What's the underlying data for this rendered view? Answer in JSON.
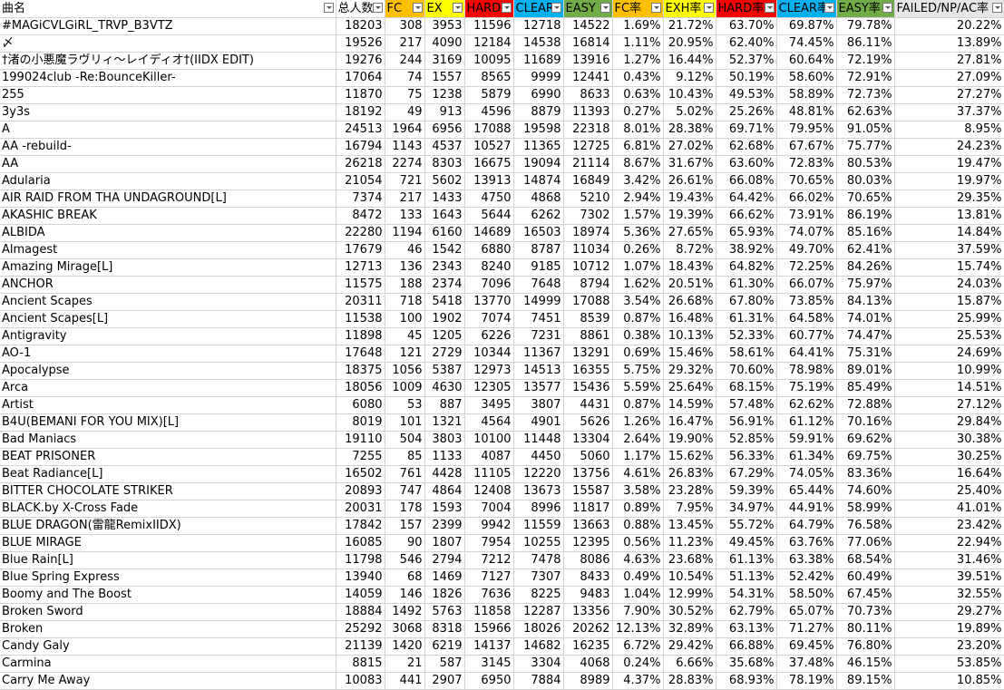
{
  "headers": [
    {
      "label": "曲名",
      "color": "#ffffff"
    },
    {
      "label": "总人数",
      "color": "#ffffff"
    },
    {
      "label": "FC",
      "color": "#ffc000"
    },
    {
      "label": "EX",
      "color": "#ffff00"
    },
    {
      "label": "HARD",
      "color": "#ff0000"
    },
    {
      "label": "CLEAR",
      "color": "#00b0f0"
    },
    {
      "label": "EASY",
      "color": "#70ad47"
    },
    {
      "label": "FC率",
      "color": "#ffc000"
    },
    {
      "label": "EXH率",
      "color": "#ffff00"
    },
    {
      "label": "HARD率",
      "color": "#ff0000"
    },
    {
      "label": "CLEAR率",
      "color": "#00b0f0"
    },
    {
      "label": "EASY率",
      "color": "#70ad47"
    },
    {
      "label": "FAILED/NP/AC率",
      "color": "#e7e6e6"
    }
  ],
  "rows": [
    [
      "#MAGiCVLGiRL_TRVP_B3VTZ",
      "18203",
      "308",
      "3953",
      "11596",
      "12718",
      "14522",
      "1.69%",
      "21.72%",
      "63.70%",
      "69.87%",
      "79.78%",
      "20.22%"
    ],
    [
      "〆",
      "19526",
      "217",
      "4090",
      "12184",
      "14538",
      "16814",
      "1.11%",
      "20.95%",
      "62.40%",
      "74.45%",
      "86.11%",
      "13.89%"
    ],
    [
      "†渚の小悪魔ラヴリィ～レイディオ†(IIDX EDIT)",
      "19276",
      "244",
      "3169",
      "10095",
      "11689",
      "13916",
      "1.27%",
      "16.44%",
      "52.37%",
      "60.64%",
      "72.19%",
      "27.81%"
    ],
    [
      "199024club -Re:BounceKiller-",
      "17064",
      "74",
      "1557",
      "8565",
      "9999",
      "12441",
      "0.43%",
      "9.12%",
      "50.19%",
      "58.60%",
      "72.91%",
      "27.09%"
    ],
    [
      "255",
      "11870",
      "75",
      "1238",
      "5879",
      "6990",
      "8633",
      "0.63%",
      "10.43%",
      "49.53%",
      "58.89%",
      "72.73%",
      "27.27%"
    ],
    [
      "3y3s",
      "18192",
      "49",
      "913",
      "4596",
      "8879",
      "11393",
      "0.27%",
      "5.02%",
      "25.26%",
      "48.81%",
      "62.63%",
      "37.37%"
    ],
    [
      "A",
      "24513",
      "1964",
      "6956",
      "17088",
      "19598",
      "22318",
      "8.01%",
      "28.38%",
      "69.71%",
      "79.95%",
      "91.05%",
      "8.95%"
    ],
    [
      "AA -rebuild-",
      "16794",
      "1143",
      "4537",
      "10527",
      "11365",
      "12725",
      "6.81%",
      "27.02%",
      "62.68%",
      "67.67%",
      "75.77%",
      "24.23%"
    ],
    [
      "AA",
      "26218",
      "2274",
      "8303",
      "16675",
      "19094",
      "21114",
      "8.67%",
      "31.67%",
      "63.60%",
      "72.83%",
      "80.53%",
      "19.47%"
    ],
    [
      "Adularia",
      "21054",
      "721",
      "5602",
      "13913",
      "14874",
      "16849",
      "3.42%",
      "26.61%",
      "66.08%",
      "70.65%",
      "80.03%",
      "19.97%"
    ],
    [
      "AIR RAID FROM THA UNDAGROUND[L]",
      "7374",
      "217",
      "1433",
      "4750",
      "4868",
      "5210",
      "2.94%",
      "19.43%",
      "64.42%",
      "66.02%",
      "70.65%",
      "29.35%"
    ],
    [
      "AKASHIC BREAK",
      "8472",
      "133",
      "1643",
      "5644",
      "6262",
      "7302",
      "1.57%",
      "19.39%",
      "66.62%",
      "73.91%",
      "86.19%",
      "13.81%"
    ],
    [
      "ALBIDA",
      "22280",
      "1194",
      "6160",
      "14689",
      "16503",
      "18974",
      "5.36%",
      "27.65%",
      "65.93%",
      "74.07%",
      "85.16%",
      "14.84%"
    ],
    [
      "Almagest",
      "17679",
      "46",
      "1542",
      "6880",
      "8787",
      "11034",
      "0.26%",
      "8.72%",
      "38.92%",
      "49.70%",
      "62.41%",
      "37.59%"
    ],
    [
      "Amazing Mirage[L]",
      "12713",
      "136",
      "2343",
      "8240",
      "9185",
      "10712",
      "1.07%",
      "18.43%",
      "64.82%",
      "72.25%",
      "84.26%",
      "15.74%"
    ],
    [
      "ANCHOR",
      "11575",
      "188",
      "2374",
      "7096",
      "7648",
      "8794",
      "1.62%",
      "20.51%",
      "61.30%",
      "66.07%",
      "75.97%",
      "24.03%"
    ],
    [
      "Ancient Scapes",
      "20311",
      "718",
      "5418",
      "13770",
      "14999",
      "17088",
      "3.54%",
      "26.68%",
      "67.80%",
      "73.85%",
      "84.13%",
      "15.87%"
    ],
    [
      "Ancient Scapes[L]",
      "11538",
      "100",
      "1902",
      "7074",
      "7451",
      "8539",
      "0.87%",
      "16.48%",
      "61.31%",
      "64.58%",
      "74.01%",
      "25.99%"
    ],
    [
      "Antigravity",
      "11898",
      "45",
      "1205",
      "6226",
      "7231",
      "8861",
      "0.38%",
      "10.13%",
      "52.33%",
      "60.77%",
      "74.47%",
      "25.53%"
    ],
    [
      "AO-1",
      "17648",
      "121",
      "2729",
      "10344",
      "11367",
      "13291",
      "0.69%",
      "15.46%",
      "58.61%",
      "64.41%",
      "75.31%",
      "24.69%"
    ],
    [
      "Apocalypse",
      "18375",
      "1056",
      "5387",
      "12973",
      "14513",
      "16355",
      "5.75%",
      "29.32%",
      "70.60%",
      "78.98%",
      "89.01%",
      "10.99%"
    ],
    [
      "Arca",
      "18056",
      "1009",
      "4630",
      "12305",
      "13577",
      "15436",
      "5.59%",
      "25.64%",
      "68.15%",
      "75.19%",
      "85.49%",
      "14.51%"
    ],
    [
      "Artist",
      "6080",
      "53",
      "887",
      "3495",
      "3807",
      "4431",
      "0.87%",
      "14.59%",
      "57.48%",
      "62.62%",
      "72.88%",
      "27.12%"
    ],
    [
      "B4U(BEMANI FOR YOU MIX)[L]",
      "8019",
      "101",
      "1321",
      "4564",
      "4901",
      "5626",
      "1.26%",
      "16.47%",
      "56.91%",
      "61.12%",
      "70.16%",
      "29.84%"
    ],
    [
      "Bad Maniacs",
      "19110",
      "504",
      "3803",
      "10100",
      "11448",
      "13304",
      "2.64%",
      "19.90%",
      "52.85%",
      "59.91%",
      "69.62%",
      "30.38%"
    ],
    [
      "BEAT PRISONER",
      "7255",
      "85",
      "1133",
      "4087",
      "4450",
      "5060",
      "1.17%",
      "15.62%",
      "56.33%",
      "61.34%",
      "69.75%",
      "30.25%"
    ],
    [
      "Beat Radiance[L]",
      "16502",
      "761",
      "4428",
      "11105",
      "12220",
      "13756",
      "4.61%",
      "26.83%",
      "67.29%",
      "74.05%",
      "83.36%",
      "16.64%"
    ],
    [
      "BITTER CHOCOLATE STRIKER",
      "20893",
      "747",
      "4864",
      "12408",
      "13673",
      "15587",
      "3.58%",
      "23.28%",
      "59.39%",
      "65.44%",
      "74.60%",
      "25.40%"
    ],
    [
      "BLACK.by X-Cross Fade",
      "20031",
      "178",
      "1593",
      "7004",
      "8996",
      "11817",
      "0.89%",
      "7.95%",
      "34.97%",
      "44.91%",
      "58.99%",
      "41.01%"
    ],
    [
      "BLUE DRAGON(雷龍RemixIIDX)",
      "17842",
      "157",
      "2399",
      "9942",
      "11559",
      "13663",
      "0.88%",
      "13.45%",
      "55.72%",
      "64.79%",
      "76.58%",
      "23.42%"
    ],
    [
      "BLUE MIRAGE",
      "16085",
      "90",
      "1807",
      "7954",
      "10255",
      "12395",
      "0.56%",
      "11.23%",
      "49.45%",
      "63.76%",
      "77.06%",
      "22.94%"
    ],
    [
      "Blue Rain[L]",
      "11798",
      "546",
      "2794",
      "7212",
      "7478",
      "8086",
      "4.63%",
      "23.68%",
      "61.13%",
      "63.38%",
      "68.54%",
      "31.46%"
    ],
    [
      "Blue Spring Express",
      "13940",
      "68",
      "1469",
      "7127",
      "7307",
      "8433",
      "0.49%",
      "10.54%",
      "51.13%",
      "52.42%",
      "60.49%",
      "39.51%"
    ],
    [
      "Boomy and The Boost",
      "14059",
      "146",
      "1826",
      "7636",
      "8225",
      "9483",
      "1.04%",
      "12.99%",
      "54.31%",
      "58.50%",
      "67.45%",
      "32.55%"
    ],
    [
      "Broken Sword",
      "18884",
      "1492",
      "5763",
      "11858",
      "12287",
      "13356",
      "7.90%",
      "30.52%",
      "62.79%",
      "65.07%",
      "70.73%",
      "29.27%"
    ],
    [
      "Broken",
      "25292",
      "3068",
      "8318",
      "15966",
      "18026",
      "20262",
      "12.13%",
      "32.89%",
      "63.13%",
      "71.27%",
      "80.11%",
      "19.89%"
    ],
    [
      "Candy Galy",
      "21139",
      "1420",
      "6219",
      "14137",
      "14682",
      "16235",
      "6.72%",
      "29.42%",
      "66.88%",
      "69.45%",
      "76.80%",
      "23.20%"
    ],
    [
      "Carmina",
      "8815",
      "21",
      "587",
      "3145",
      "3304",
      "4068",
      "0.24%",
      "6.66%",
      "35.68%",
      "37.48%",
      "46.15%",
      "53.85%"
    ],
    [
      "Carry Me Away",
      "10083",
      "441",
      "2907",
      "6950",
      "7884",
      "8989",
      "4.37%",
      "28.83%",
      "68.93%",
      "78.19%",
      "89.15%",
      "10.85%"
    ]
  ]
}
